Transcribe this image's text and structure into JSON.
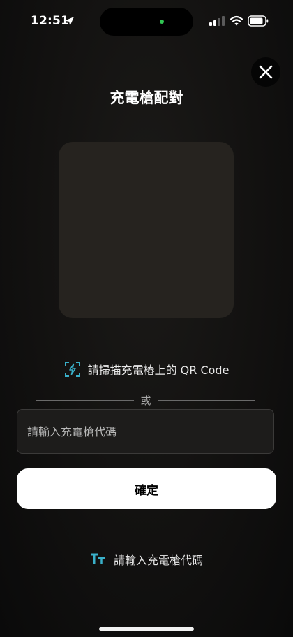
{
  "status_bar": {
    "time": "12:51"
  },
  "header": {
    "title": "充電槍配對"
  },
  "scan": {
    "hint": "請掃描充電樁上的 QR Code"
  },
  "divider": {
    "label": "或"
  },
  "code_input": {
    "placeholder": "請輸入充電槍代碼",
    "value": ""
  },
  "confirm": {
    "label": "確定"
  },
  "manual_entry": {
    "label": "請輸入充電槍代碼"
  },
  "colors": {
    "accent": "#3ab0c9",
    "background": "#121110",
    "scanner_fill": "#26231f",
    "button_bg": "#ffffff"
  },
  "icons": {
    "close": "close-icon",
    "scan": "qr-scan-icon",
    "text": "text-size-icon",
    "location": "location-arrow-icon"
  }
}
